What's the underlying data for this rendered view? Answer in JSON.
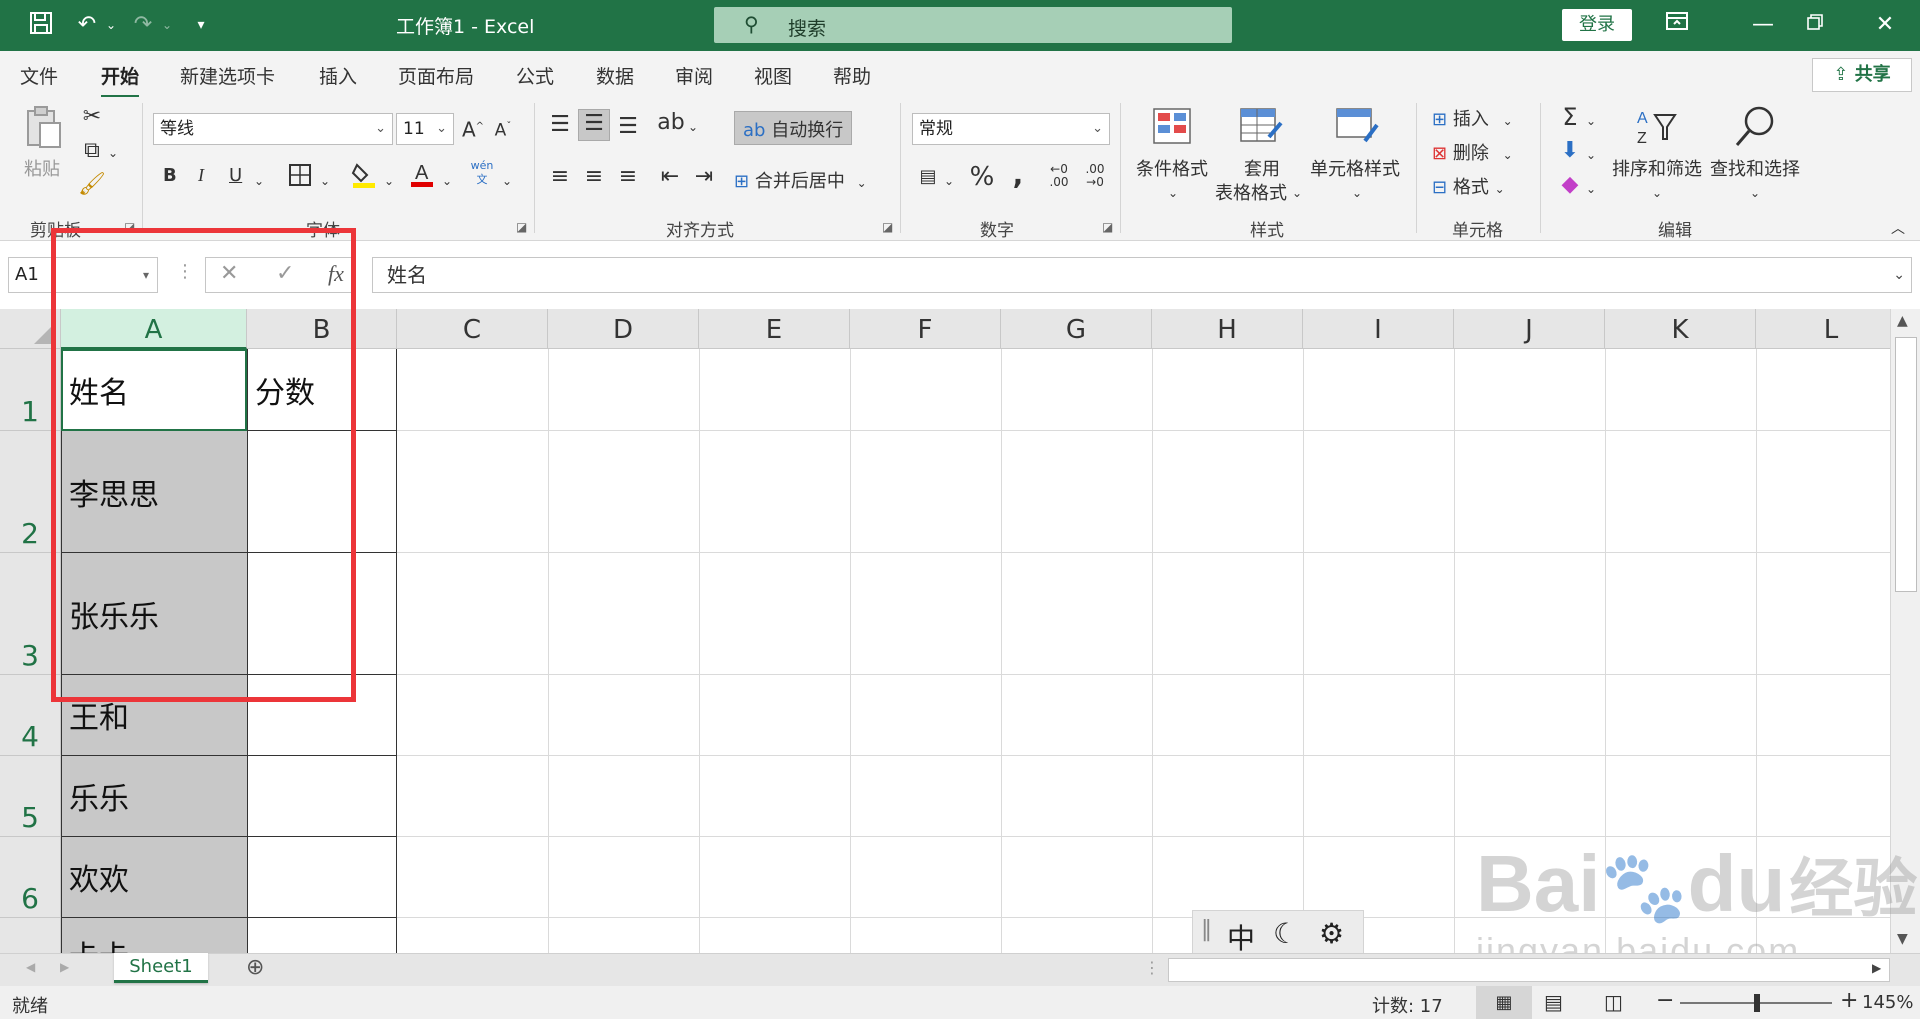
{
  "titlebar": {
    "title": "工作簿1  -  Excel",
    "search_placeholder": "搜索",
    "login_label": "登录"
  },
  "menu": {
    "tabs": [
      "文件",
      "开始",
      "新建选项卡",
      "插入",
      "页面布局",
      "公式",
      "数据",
      "审阅",
      "视图",
      "帮助"
    ],
    "active_tab": "开始",
    "share_label": "共享"
  },
  "ribbon": {
    "clipboard": {
      "paste_label": "粘贴",
      "group_label": "剪贴板"
    },
    "font": {
      "font_name": "等线",
      "font_size": "11",
      "bold": "B",
      "italic": "I",
      "underline": "U",
      "group_label": "字体"
    },
    "alignment": {
      "wrap_label": "自动换行",
      "merge_label": "合并后居中",
      "group_label": "对齐方式"
    },
    "number": {
      "format": "常规",
      "group_label": "数字"
    },
    "styles": {
      "conditional_label": "条件格式",
      "table_label_1": "套用",
      "table_label_2": "表格格式",
      "cell_style_label": "单元格样式",
      "group_label": "样式"
    },
    "cells": {
      "insert_label": "插入",
      "delete_label": "删除",
      "format_label": "格式",
      "group_label": "单元格"
    },
    "editing": {
      "sort_label": "排序和筛选",
      "find_label": "查找和选择",
      "group_label": "编辑"
    }
  },
  "formula_bar": {
    "name_box": "A1",
    "content": "姓名"
  },
  "sheet": {
    "columns": [
      "A",
      "B",
      "C",
      "D",
      "E",
      "F",
      "G",
      "H",
      "I",
      "J",
      "K",
      "L"
    ],
    "rows": [
      "1",
      "2",
      "3",
      "4",
      "5",
      "6"
    ],
    "cells": {
      "A1": "姓名",
      "B1": "分数",
      "A2": "李思思",
      "A3": "张乐乐",
      "A4": "王和",
      "A5": "乐乐",
      "A6": "欢欢",
      "A7": "卡卡"
    },
    "tab_name": "Sheet1"
  },
  "status": {
    "ready": "就绪",
    "count": "计数: 17",
    "zoom": "145%"
  },
  "ime": {
    "mode": "中"
  },
  "watermark": {
    "line1": "Bai",
    "line2": "du",
    "line3": "经验",
    "line4": "jingyan.baidu.com"
  },
  "colors": {
    "accent": "#217346",
    "highlight_box": "#ec3539"
  }
}
